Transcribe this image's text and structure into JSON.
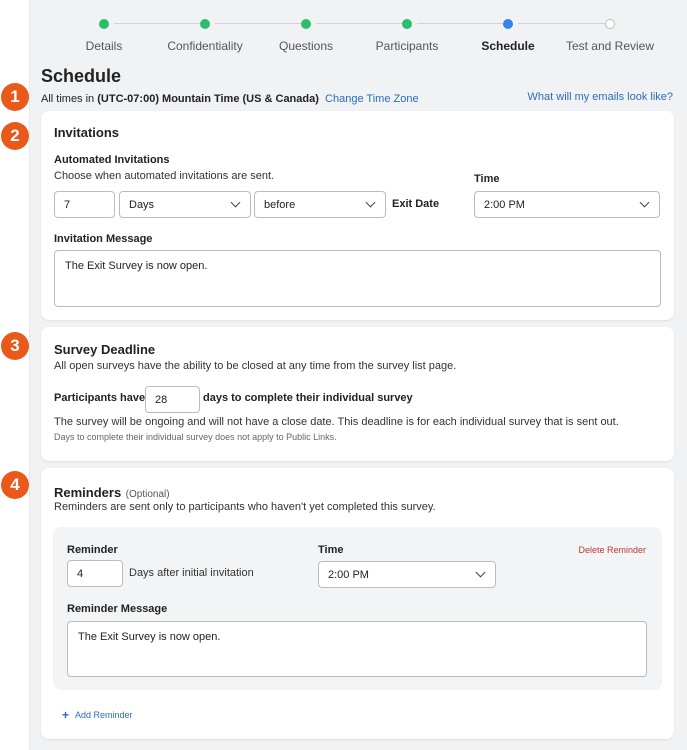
{
  "stepper": {
    "steps": [
      {
        "label": "Details",
        "state": "done"
      },
      {
        "label": "Confidentiality",
        "state": "done"
      },
      {
        "label": "Questions",
        "state": "done"
      },
      {
        "label": "Participants",
        "state": "done"
      },
      {
        "label": "Schedule",
        "state": "current"
      },
      {
        "label": "Test and Review",
        "state": "todo"
      }
    ]
  },
  "page_title": "Schedule",
  "timezone": {
    "prefix": "All times in",
    "value": "(UTC-07:00) Mountain Time (US & Canada)",
    "change_link": "Change Time Zone"
  },
  "email_preview_link": "What will my emails look like?",
  "badges": [
    "1",
    "2",
    "3",
    "4"
  ],
  "invitations": {
    "title": "Invitations",
    "automated_label": "Automated Invitations",
    "automated_desc": "Choose when automated invitations are sent.",
    "offset_value": "7",
    "unit_value": "Days",
    "relation_value": "before",
    "anchor_label": "Exit Date",
    "time_label": "Time",
    "time_value": "2:00 PM",
    "message_label": "Invitation Message",
    "message_value": "The Exit Survey is now open."
  },
  "deadline": {
    "title": "Survey Deadline",
    "desc": "All open surveys have the ability to be closed at any time from the survey list page.",
    "participants_prefix": "Participants have",
    "days_value": "28",
    "participants_suffix": "days to complete their individual survey",
    "note": "The survey will be ongoing and will not have a close date. This deadline is for each individual survey that is sent out.",
    "small_note": "Days to complete their individual survey does not apply to Public Links."
  },
  "reminders": {
    "title": "Reminders",
    "optional": "(Optional)",
    "desc": "Reminders are sent only to participants who haven't yet completed this survey.",
    "reminder_label": "Reminder",
    "days_value": "4",
    "days_suffix": "Days after initial invitation",
    "time_label": "Time",
    "time_value": "2:00 PM",
    "delete_label": "Delete Reminder",
    "message_label": "Reminder Message",
    "message_value": "The Exit Survey is now open.",
    "add_label": "Add Reminder"
  },
  "colors": {
    "step_done": "#2ebd6b",
    "step_current": "#3b82e6",
    "badge": "#e8591a",
    "link": "#2a6ebb",
    "delete": "#c0392b"
  }
}
